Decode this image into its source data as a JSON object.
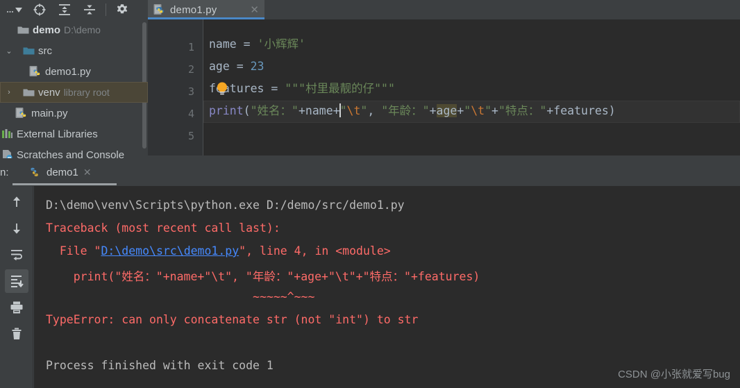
{
  "toolbar": {
    "buttons": [
      {
        "name": "more-options-dropdown",
        "icon": "ellipsis-dropdown-icon",
        "glyph": "▾"
      },
      {
        "name": "locate-file-button",
        "icon": "crosshair-target-icon",
        "glyph": "⊕"
      },
      {
        "name": "expand-all-button",
        "icon": "expand-all-icon",
        "glyph": "⇕"
      },
      {
        "name": "collapse-all-button",
        "icon": "collapse-all-icon",
        "glyph": "⇵"
      },
      {
        "name": "settings-button",
        "icon": "gear-icon",
        "glyph": "⚙"
      }
    ]
  },
  "tabs": [
    {
      "label": "demo1.py",
      "icon": "python-file-icon",
      "close": "✕",
      "active": true
    }
  ],
  "tree": {
    "items": [
      {
        "label": "demo",
        "hint": "D:\\demo",
        "icon": "folder-icon",
        "arrow": "",
        "indent": 6,
        "bold": true,
        "selected": false
      },
      {
        "label": "src",
        "hint": "",
        "icon": "folder-src-icon",
        "arrow": "⌄",
        "indent": 6,
        "bold": false,
        "selected": false
      },
      {
        "label": "demo1.py",
        "hint": "",
        "icon": "python-file-icon",
        "arrow": "",
        "indent": 42,
        "bold": false,
        "selected": false
      },
      {
        "label": "venv",
        "hint": "library root",
        "icon": "folder-icon",
        "arrow": "›",
        "indent": 6,
        "bold": false,
        "selected": true
      },
      {
        "label": "main.py",
        "hint": "",
        "icon": "python-file-icon",
        "arrow": "",
        "indent": 24,
        "bold": false,
        "selected": false
      },
      {
        "label": "External Libraries",
        "hint": "",
        "icon": "libraries-icon",
        "arrow": "",
        "indent": 2,
        "bold": false,
        "selected": false
      },
      {
        "label": "Scratches and Console",
        "hint": "",
        "icon": "scratches-icon",
        "arrow": "",
        "indent": 2,
        "bold": false,
        "selected": false
      }
    ]
  },
  "editor": {
    "line_numbers": [
      "1",
      "2",
      "3",
      "4",
      "5"
    ],
    "lines": [
      {
        "no": "1",
        "tokens": [
          {
            "t": "name ",
            "c": "sy-plain"
          },
          {
            "t": "= ",
            "c": "sy-plain"
          },
          {
            "t": "'小辉辉'",
            "c": "sy-str"
          }
        ]
      },
      {
        "no": "2",
        "tokens": [
          {
            "t": "age ",
            "c": "sy-plain"
          },
          {
            "t": "= ",
            "c": "sy-plain"
          },
          {
            "t": "23",
            "c": "sy-num"
          }
        ]
      },
      {
        "no": "3",
        "tokens": [
          {
            "t": "features ",
            "c": "sy-plain"
          },
          {
            "t": "= ",
            "c": "sy-plain"
          },
          {
            "t": "\"\"\"村里最靓的仔\"\"\"",
            "c": "sy-str"
          }
        ]
      },
      {
        "no": "4",
        "tokens": [
          {
            "t": "print",
            "c": "sy-func"
          },
          {
            "t": "(",
            "c": "sy-paren"
          },
          {
            "t": "\"姓名：\"",
            "c": "sy-str"
          },
          {
            "t": "+",
            "c": "sy-plain"
          },
          {
            "t": "name",
            "c": "sy-plain"
          },
          {
            "t": "+",
            "c": "sy-plain"
          },
          {
            "t": "CARET",
            "c": "caret"
          },
          {
            "t": "\"",
            "c": "sy-str"
          },
          {
            "t": "\\t",
            "c": "sy-esc"
          },
          {
            "t": "\"",
            "c": "sy-str"
          },
          {
            "t": ", ",
            "c": "sy-plain"
          },
          {
            "t": "\"年龄：\"",
            "c": "sy-str"
          },
          {
            "t": "+",
            "c": "sy-plain"
          },
          {
            "t": "age",
            "c": "sy-plain hl-ident"
          },
          {
            "t": "+",
            "c": "sy-plain"
          },
          {
            "t": "\"",
            "c": "sy-str"
          },
          {
            "t": "\\t",
            "c": "sy-esc"
          },
          {
            "t": "\"",
            "c": "sy-str"
          },
          {
            "t": "+",
            "c": "sy-plain"
          },
          {
            "t": "\"特点：\"",
            "c": "sy-str"
          },
          {
            "t": "+",
            "c": "sy-plain"
          },
          {
            "t": "features",
            "c": "sy-plain"
          },
          {
            "t": ")",
            "c": "sy-paren"
          }
        ]
      },
      {
        "no": "5",
        "tokens": []
      }
    ],
    "intention_bulb": "lightbulb-icon"
  },
  "run_panel": {
    "prefix_label": "n:",
    "tab": {
      "label": "demo1",
      "icon": "python-config-icon",
      "close": "✕"
    },
    "sidebar_buttons": [
      {
        "name": "scroll-up-button",
        "icon": "arrow-up-icon",
        "active": false
      },
      {
        "name": "scroll-down-button",
        "icon": "arrow-down-icon",
        "active": false
      },
      {
        "name": "soft-wrap-button",
        "icon": "soft-wrap-icon",
        "active": false
      },
      {
        "name": "scroll-to-end-button",
        "icon": "scroll-to-end-icon",
        "active": true
      },
      {
        "name": "print-button",
        "icon": "printer-icon",
        "active": false
      },
      {
        "name": "clear-all-button",
        "icon": "trash-icon",
        "active": false
      }
    ],
    "console_lines": [
      {
        "segments": [
          {
            "t": "D:\\demo\\venv\\Scripts\\python.exe D:/demo/src/demo1.py",
            "c": "c-out"
          }
        ]
      },
      {
        "segments": [
          {
            "t": "Traceback (most recent call last):",
            "c": "c-err"
          }
        ]
      },
      {
        "segments": [
          {
            "t": "  File \"",
            "c": "c-err"
          },
          {
            "t": "D:\\demo\\src\\demo1.py",
            "c": "c-link"
          },
          {
            "t": "\", line 4, in <module>",
            "c": "c-err"
          }
        ]
      },
      {
        "segments": [
          {
            "t": "    print(\"姓名：\"+name+\"\\t\", \"年龄：\"+age+\"\\t\"+\"特点：\"+features)",
            "c": "c-err"
          }
        ]
      },
      {
        "segments": [
          {
            "t": "                              ~~~~~^~~~",
            "c": "c-err"
          }
        ]
      },
      {
        "segments": [
          {
            "t": "TypeError: can only concatenate str (not \"int\") to str",
            "c": "c-err"
          }
        ]
      },
      {
        "segments": [
          {
            "t": "",
            "c": "c-out"
          }
        ]
      },
      {
        "segments": [
          {
            "t": "Process finished with exit code 1",
            "c": "c-out"
          }
        ]
      }
    ]
  },
  "watermark": {
    "text": "CSDN @小张就爱写bug"
  },
  "colors": {
    "chrome_bg": "#3c3f41",
    "editor_bg": "#2b2b2b",
    "gutter_bg": "#313335",
    "tab_active_bg": "#4e5254",
    "tab_underline": "#4a88c7",
    "selection_tree": "#4b4637",
    "string": "#6a8759",
    "number": "#6897bb",
    "function": "#8888c6",
    "escape": "#cc7832",
    "error_red": "#ff6b68",
    "link_blue": "#468aff",
    "text": "#a9b7c6"
  }
}
